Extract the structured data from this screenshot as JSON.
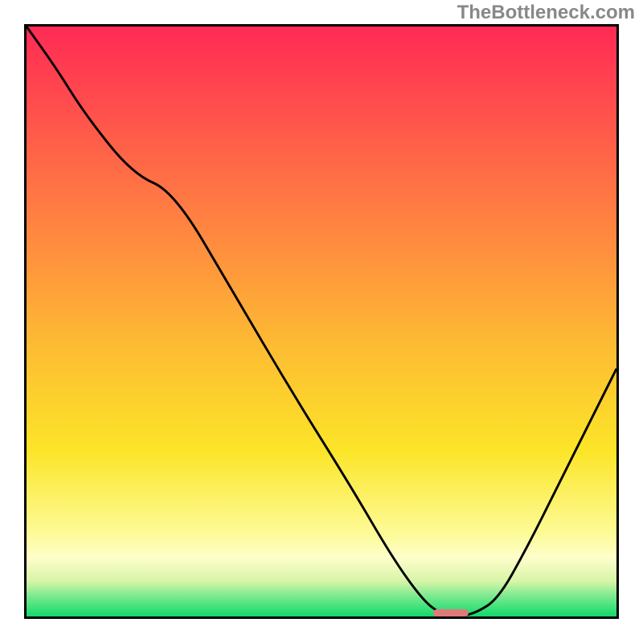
{
  "watermark": "TheBottleneck.com",
  "chart_data": {
    "type": "line",
    "title": "",
    "xlabel": "",
    "ylabel": "",
    "xlim": [
      0,
      100
    ],
    "ylim": [
      0,
      100
    ],
    "grid": false,
    "background_gradient": {
      "stops": [
        {
          "pct": 0,
          "color": "#ff2a55"
        },
        {
          "pct": 18,
          "color": "#ff5a4a"
        },
        {
          "pct": 36,
          "color": "#ff8a3f"
        },
        {
          "pct": 54,
          "color": "#fdbb33"
        },
        {
          "pct": 72,
          "color": "#fce528"
        },
        {
          "pct": 86,
          "color": "#fdfb98"
        },
        {
          "pct": 90,
          "color": "#fefecb"
        },
        {
          "pct": 94,
          "color": "#d7f5a8"
        },
        {
          "pct": 97,
          "color": "#6be88a"
        },
        {
          "pct": 100,
          "color": "#12d96b"
        }
      ]
    },
    "series": [
      {
        "name": "bottleneck-curve",
        "x": [
          0,
          5,
          10,
          18,
          25,
          35,
          45,
          55,
          62,
          67,
          70,
          73,
          76,
          80,
          85,
          90,
          95,
          100
        ],
        "y": [
          100,
          93,
          85,
          75,
          72,
          55,
          38,
          22,
          10,
          3,
          0.5,
          0,
          0.5,
          3,
          12,
          22,
          32,
          42
        ]
      }
    ],
    "marker": {
      "label": "optimal-point",
      "x": 72,
      "y": 0,
      "width_pct": 6,
      "height_pct": 1.2,
      "color": "#e07a7a"
    }
  }
}
